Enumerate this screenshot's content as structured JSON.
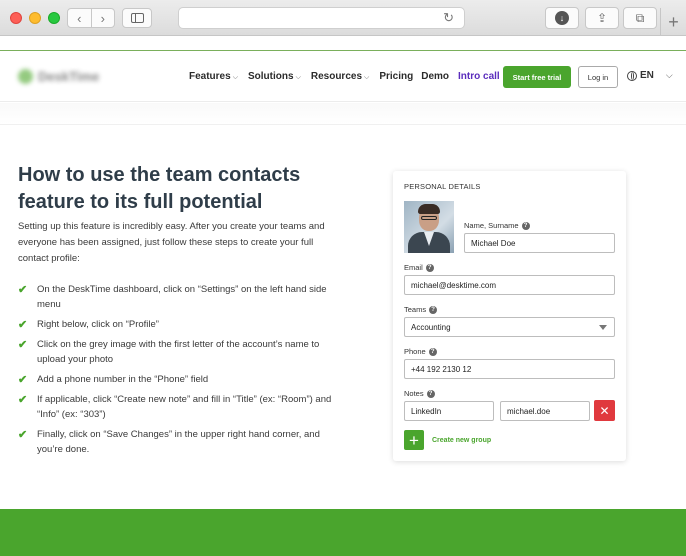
{
  "browser": {
    "back_glyph": "‹",
    "forward_glyph": "›",
    "reload_glyph": "↻",
    "new_tab_glyph": "+",
    "download_glyph": "↓",
    "share_glyph": "⇪",
    "tabs_glyph": "⧉"
  },
  "header": {
    "logo_text": "DeskTime",
    "nav": {
      "features": "Features",
      "solutions": "Solutions",
      "resources": "Resources",
      "pricing": "Pricing",
      "demo": "Demo",
      "intro_call": "Intro call"
    },
    "chevron_glyph": "⌵",
    "trial_button": "Start free trial",
    "login_button": "Log in",
    "language": "EN"
  },
  "main": {
    "heading": "How to use the team contacts feature to its full potential",
    "intro": "Setting up this feature is incredibly easy. After you create your teams and everyone has been assigned, just follow these steps to create your full contact profile:",
    "check_glyph": "✔",
    "steps": [
      "On the DeskTime dashboard, click on “Settings” on the left hand side menu",
      "Right below, click on “Profile”",
      "Click on the grey image with the first letter of the account’s name to upload your photo",
      "Add a phone number in the “Phone” field",
      "If applicable, click “Create new note” and fill in “Title” (ex: “Room”) and “Info” (ex: “303”)",
      "Finally, click on “Save Changes” in the upper right hand corner, and you’re done."
    ]
  },
  "card": {
    "title": "PERSONAL DETAILS",
    "help_glyph": "?",
    "name_label": "Name, Surname",
    "name_value": "Michael Doe",
    "email_label": "Email",
    "email_value": "michael@desktime.com",
    "teams_label": "Teams",
    "teams_value": "Accounting",
    "phone_label": "Phone",
    "phone_value": "+44 192 2130 12",
    "notes_label": "Notes",
    "note_title": "LinkedIn",
    "note_info": "michael.doe",
    "delete_glyph": "✕",
    "add_glyph": "+",
    "create_group": "Create new group"
  },
  "colors": {
    "brand_green": "#4aa52d",
    "intro_call_purple": "#5b2dbd",
    "delete_red": "#e0393e"
  }
}
